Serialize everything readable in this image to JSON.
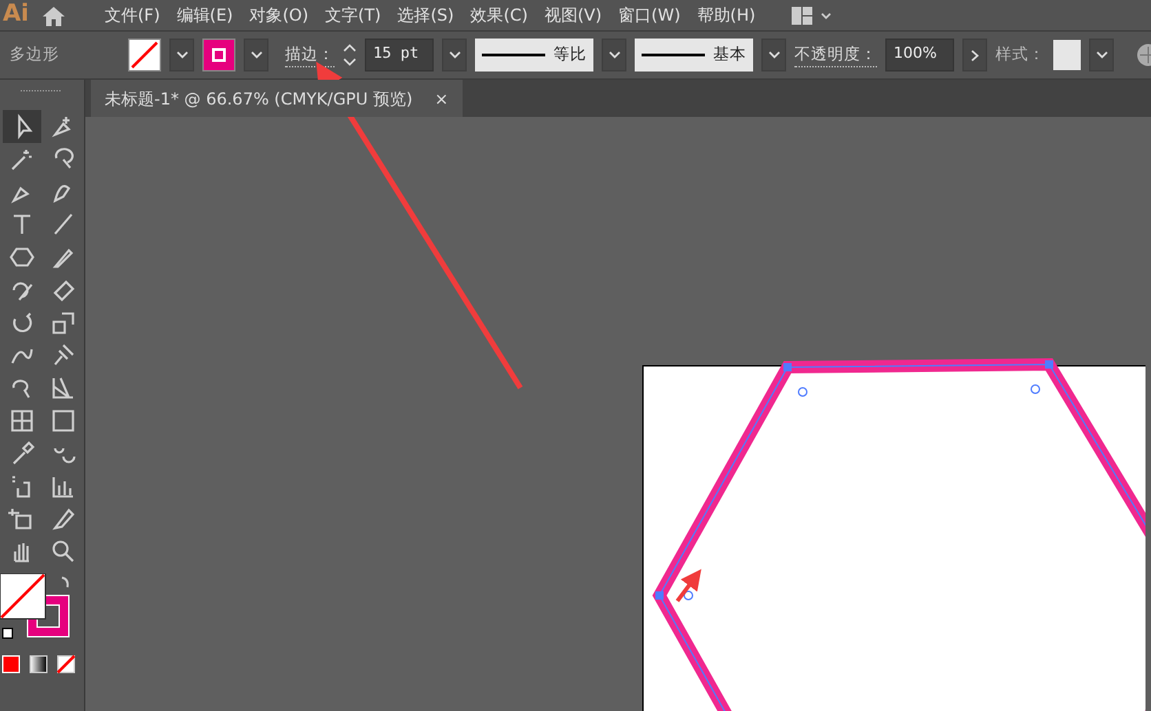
{
  "menu_bar": {
    "logo": "Ai",
    "menus": [
      {
        "label": "文件(F)",
        "selected": false
      },
      {
        "label": "编辑(E)",
        "selected": false
      },
      {
        "label": "对象(O)",
        "selected": false
      },
      {
        "label": "文字(T)",
        "selected": false
      },
      {
        "label": "选择(S)",
        "selected": false
      },
      {
        "label": "效果(C)",
        "selected": false
      },
      {
        "label": "视图(V)",
        "selected": false
      },
      {
        "label": "窗口(W)",
        "selected": false
      },
      {
        "label": "帮助(H)",
        "selected": false
      }
    ]
  },
  "control_bar": {
    "selection_type": "多边形",
    "fill": {
      "color": "#ffffff"
    },
    "stroke": {
      "color": "#e6007e"
    },
    "stroke_label": "描边：",
    "stroke_weight": "15 pt",
    "profile": "等比",
    "brush": "基本",
    "opacity_label": "不透明度：",
    "opacity": "100%",
    "style_label": "样式："
  },
  "document_tab": {
    "title": "未标题-1* @ 66.67% (CMYK/GPU 预览)",
    "close": "×"
  },
  "toolbar": {
    "tools": [
      {
        "selected": true
      },
      {
        "selected": false
      },
      {
        "selected": false
      },
      {
        "selected": false
      },
      {
        "selected": false
      },
      {
        "selected": false
      },
      {
        "selected": false
      },
      {
        "selected": false
      },
      {
        "selected": false
      },
      {
        "selected": false
      },
      {
        "selected": false
      },
      {
        "selected": false
      },
      {
        "selected": false
      },
      {
        "selected": false
      },
      {
        "selected": false
      },
      {
        "selected": false
      },
      {
        "selected": false
      },
      {
        "selected": false
      },
      {
        "selected": false
      },
      {
        "selected": false
      },
      {
        "selected": false
      },
      {
        "selected": false
      },
      {
        "selected": false
      },
      {
        "selected": false
      },
      {
        "selected": false
      },
      {
        "selected": false
      },
      {
        "selected": false
      },
      {
        "selected": false
      }
    ]
  }
}
